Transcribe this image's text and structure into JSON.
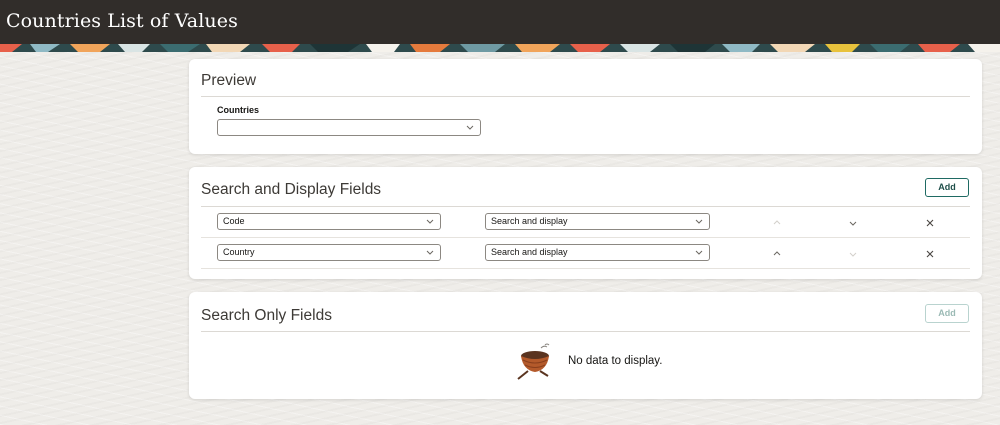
{
  "header": {
    "title": "Countries List of Values"
  },
  "preview": {
    "title": "Preview",
    "field_label": "Countries",
    "field_value": ""
  },
  "search_display": {
    "title": "Search and Display Fields",
    "add_label": "Add",
    "rows": [
      {
        "field": "Code",
        "mode": "Search and display",
        "up_enabled": false,
        "down_enabled": true
      },
      {
        "field": "Country",
        "mode": "Search and display",
        "up_enabled": true,
        "down_enabled": false
      }
    ]
  },
  "search_only": {
    "title": "Search Only Fields",
    "add_label": "Add",
    "add_enabled": false,
    "empty_text": "No data to display."
  },
  "icons": {
    "chevron": "chevron-down-icon",
    "up": "arrow-up-icon",
    "down": "arrow-down-icon",
    "delete": "close-icon",
    "empty": "empty-nest-icon"
  },
  "colors": {
    "header_bg": "#312d2a",
    "accent": "#1f6a63",
    "page_bg": "#efede9"
  }
}
